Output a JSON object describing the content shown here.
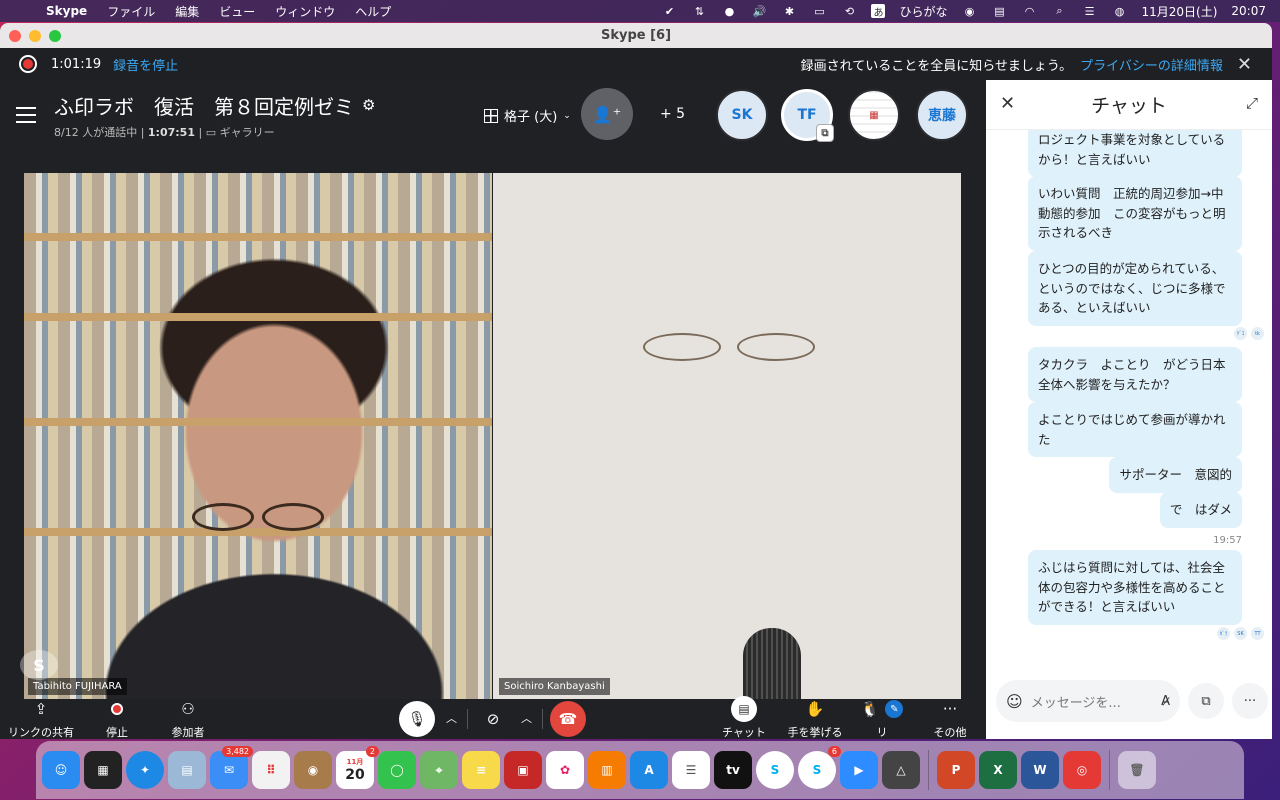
{
  "menubar": {
    "apple_icon": "apple-icon",
    "app_name": "Skype",
    "items": [
      "ファイル",
      "編集",
      "ビュー",
      "ウィンドウ",
      "ヘルプ"
    ],
    "ime_label": "あ",
    "ime_name": "ひらがな",
    "date": "11月20日(土)",
    "time": "20:07"
  },
  "window": {
    "title": "Skype [6]"
  },
  "recording": {
    "elapsed": "1:01:19",
    "stop_label": "録音を停止",
    "notice": "録画されていることを全員に知らせましょう。",
    "privacy_link": "プライバシーの詳細情報"
  },
  "call_header": {
    "title": "ふ印ラボ　復活　第８回定例ゼミ",
    "participants": "8/12 人が通話中",
    "duration": "1:07:51",
    "view": "ギャラリー",
    "view_mode": "格子 (大)",
    "extra_count": "+ 5",
    "avatars": [
      "SK",
      "TF",
      "",
      "恵藤"
    ]
  },
  "videos": [
    {
      "name": "Tabihito FUJIHARA"
    },
    {
      "name": "Soichiro Kanbayashi"
    }
  ],
  "controls": {
    "share_link": "リンクの共有",
    "stop": "停止",
    "participants": "参加者",
    "chat": "チャット",
    "raise_hand": "手を挙げる",
    "react": "リ",
    "more": "その他"
  },
  "chat": {
    "title": "チャット",
    "messages": [
      "ロジェクト事業を対象としているから！と言えばいい",
      "いわい質問　正統的周辺参加→中動態的参加　この変容がもっと明示されるべき",
      "ひとつの目的が定められている、というのではなく、じつに多様である、といえばいい",
      "タカクラ　よことり　がどう日本全体へ影響を与えたか？",
      "よことりではじめて参画が導かれた",
      "サポーター　意図的",
      "で　はダメ",
      "ふじはら質問に対しては、社会全体の包容力や多様性を高めることができる！と言えばいい"
    ],
    "timestamp": "19:57",
    "reactions_1": [
      "ｹﾞｺ",
      "tk"
    ],
    "reactions_2": [
      "ｶﾞﾗ",
      "SK",
      "TT"
    ],
    "placeholder": "メッセージを..."
  },
  "dock": {
    "mail_badge": "3,482",
    "calendar_month": "11月",
    "calendar_day": "20",
    "calendar_badge": "2",
    "skype_badge": "6",
    "tv_label": "tv"
  }
}
